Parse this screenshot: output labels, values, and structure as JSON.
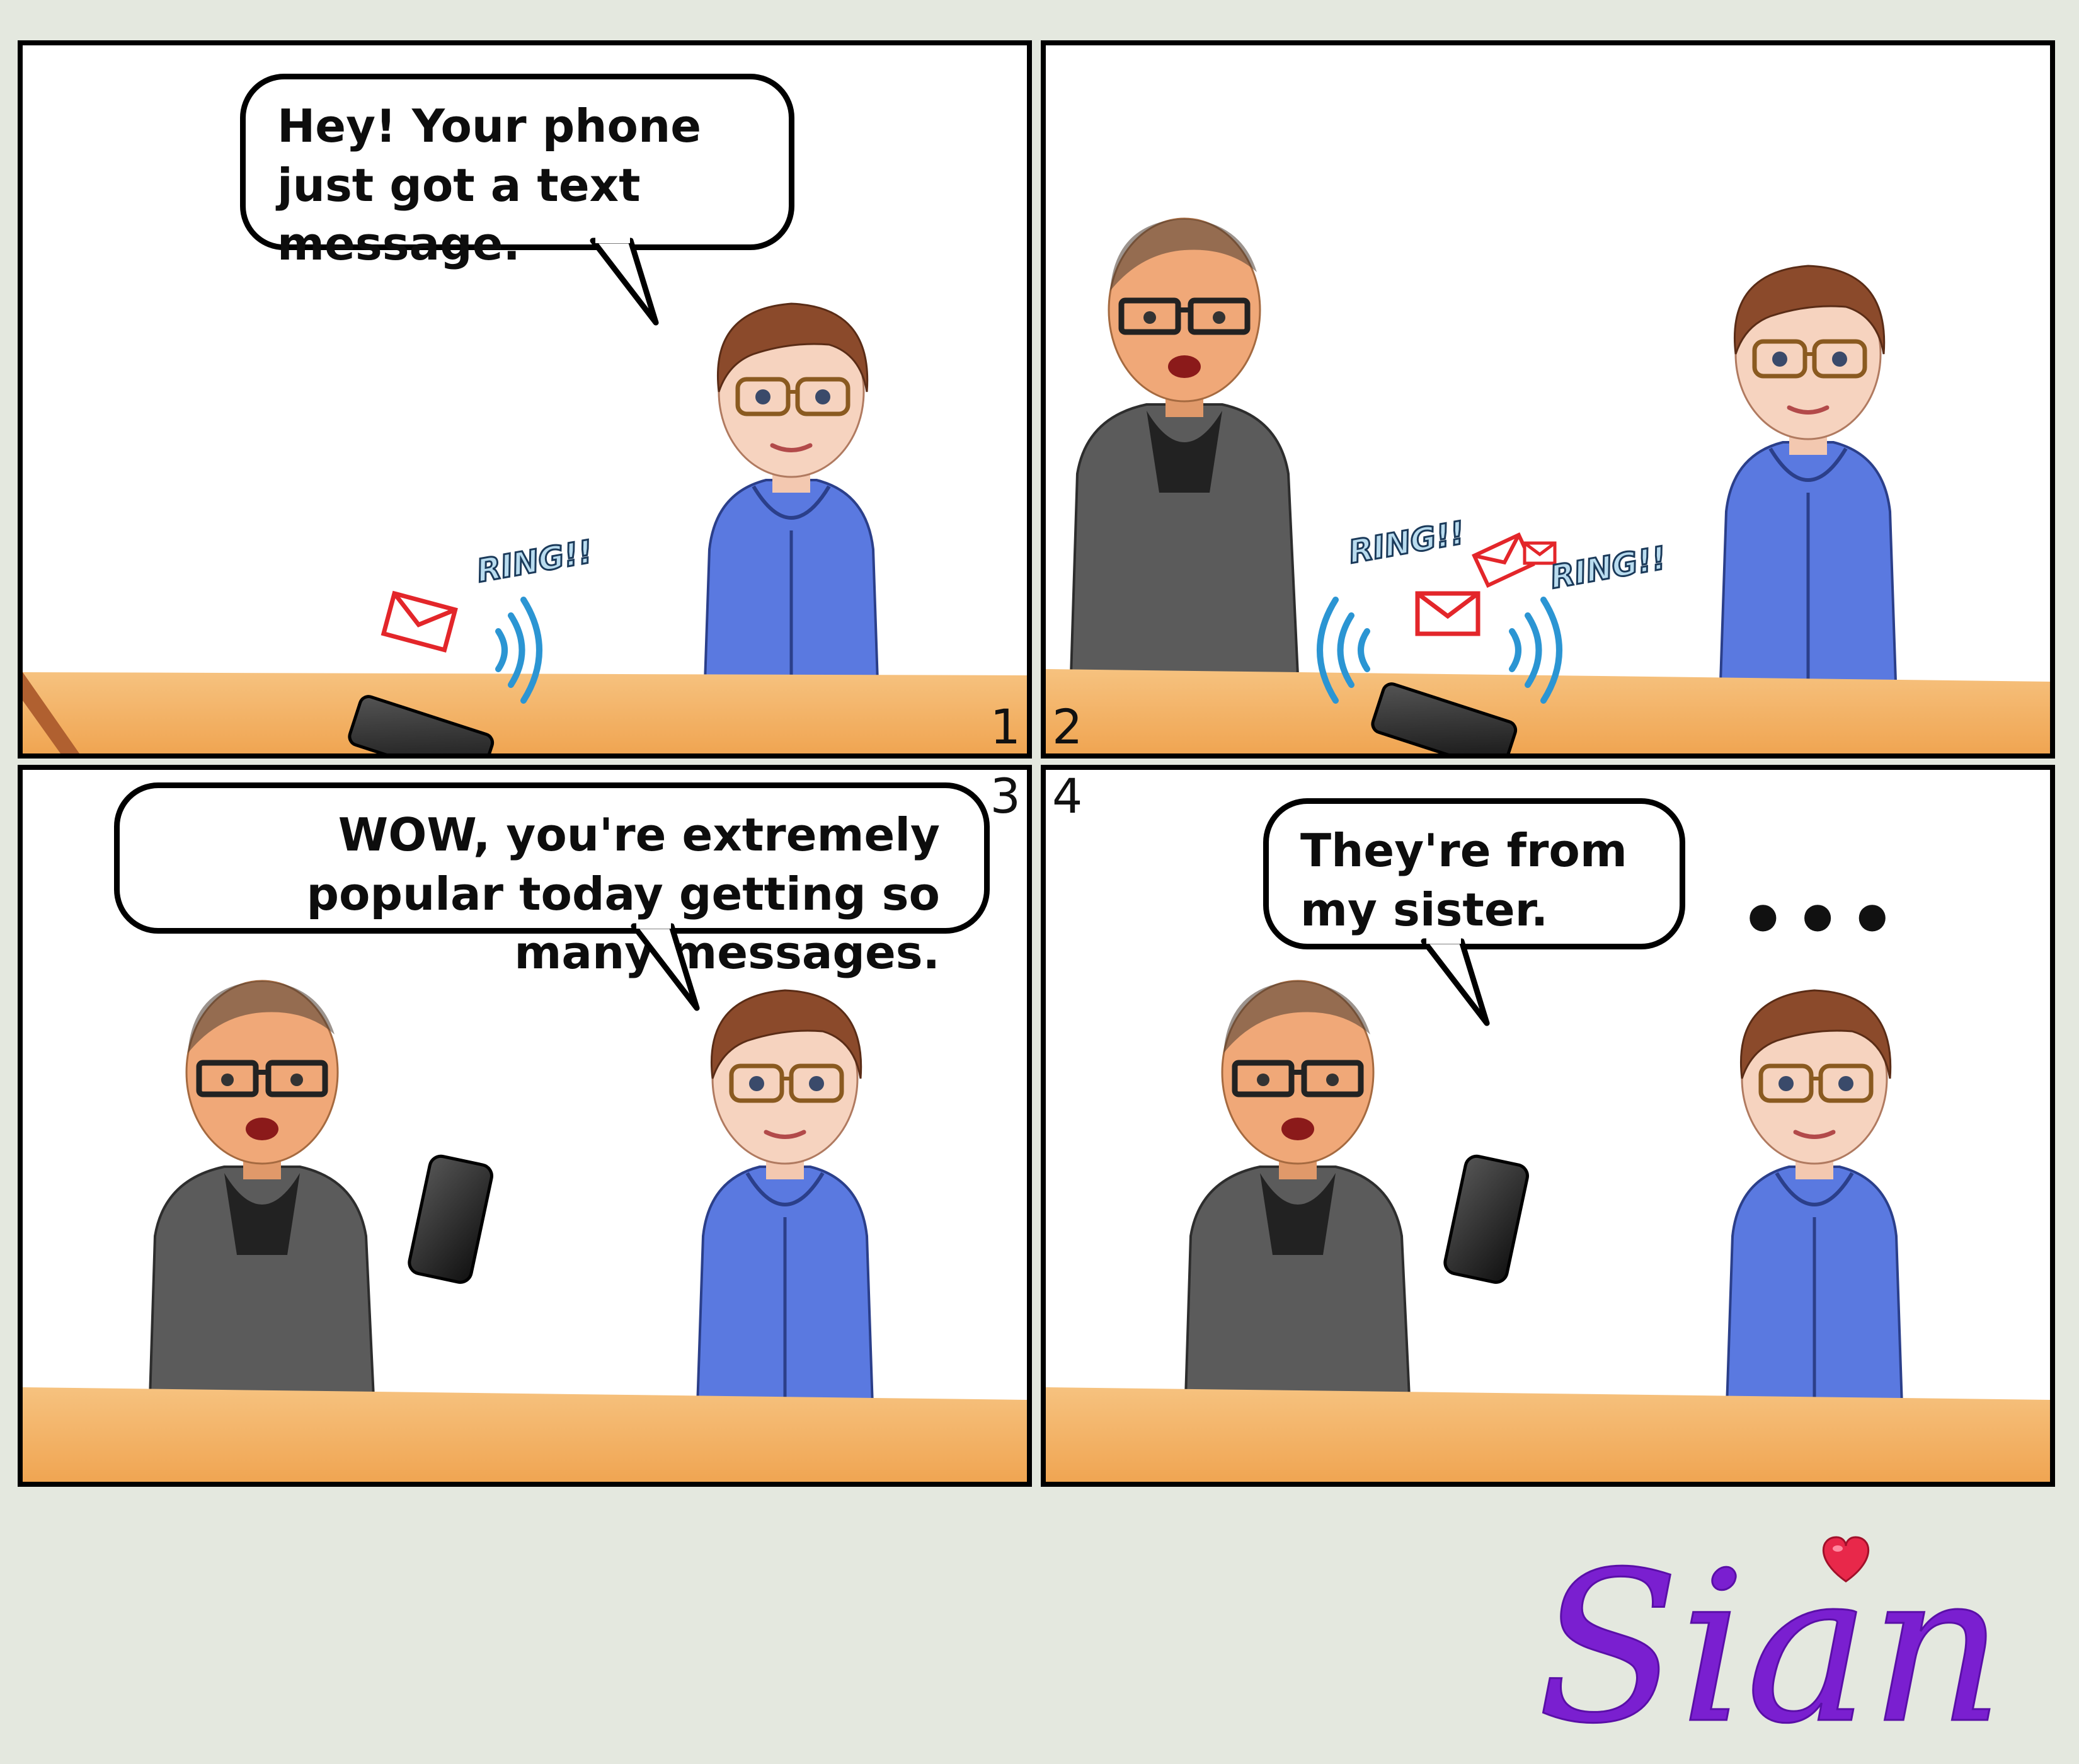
{
  "panels": [
    {
      "number": "1",
      "bubble": "Hey! Your phone just got a text message.",
      "sfx": [
        "RING!!"
      ]
    },
    {
      "number": "2",
      "sfx": [
        "RING!!",
        "RING!!"
      ]
    },
    {
      "number": "3",
      "bubble": "WOW, you're extremely popular today getting so many messages."
    },
    {
      "number": "4",
      "bubble": "They're from my sister.",
      "thought": "•••"
    }
  ],
  "signature": "Sian",
  "colors": {
    "background": "#e4e8df",
    "desk": "#f2b56a",
    "hoodie_blue": "#5a79e0",
    "sweater_gray": "#5b5b5b",
    "signature_purple": "#7a1fd0",
    "heart": "#e8284a"
  },
  "icons": [
    "envelope-icon",
    "signal-waves-icon",
    "heart-icon",
    "smartphone-icon"
  ]
}
